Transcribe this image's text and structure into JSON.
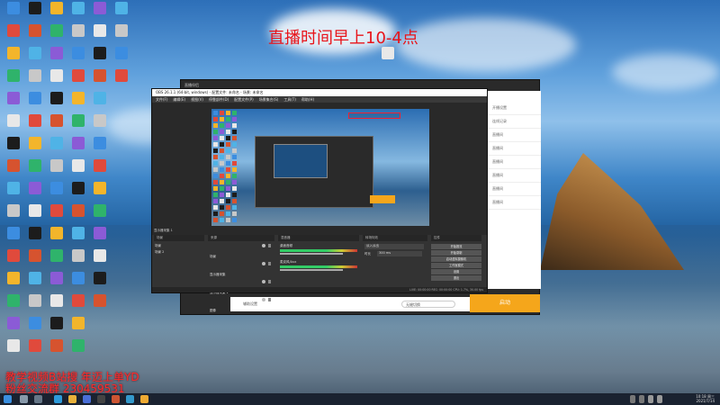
{
  "overlay": {
    "banner": "直播时间早上10-4点",
    "promo_line1": "教学视频B站搜 年迈上单YD",
    "promo_line2": "粉丝交流群 230459531",
    "red_color": "#e8141a"
  },
  "obs": {
    "window_title": "OBS 26.1.1 (64-bit, windows) - 配置文件: 未命名 - 场景: 未命名",
    "menu": [
      "文件(F)",
      "编辑(E)",
      "视图(V)",
      "停靠部件(D)",
      "配置文件(P)",
      "场景集合(S)",
      "工具(T)",
      "帮助(H)"
    ],
    "source_bar": "显示器采集 1",
    "panels": {
      "scenes_header": "场景",
      "sources_header": "来源",
      "mixer_header": "混音器",
      "transitions_header": "转场特效",
      "controls_header": "控件"
    },
    "scenes": [
      "场景",
      "场景 2"
    ],
    "sources": [
      "场景",
      "显示器采集",
      "显示器采集 2",
      "图像"
    ],
    "mixer": [
      "桌面音频",
      "麦克风/Aux"
    ],
    "transition": {
      "type": "淡入淡出",
      "duration_label": "时长",
      "duration": "300 ms"
    },
    "controls": [
      "开始推流",
      "开始录制",
      "启动虚拟摄像机",
      "工作室模式",
      "设置",
      "退出"
    ],
    "status": "LIVE: 00:00:00   REC: 00:00:00   CPU: 1.7%, 30.00 fps"
  },
  "live_window": {
    "title": "直播伴侣",
    "start_button": "启动",
    "bottom_label": "辅助设置",
    "mode_label": "无缝切换",
    "side_items": [
      "开播设置",
      "连线记录",
      "直播间",
      "直播间",
      "直播间",
      "直播间",
      "直播间",
      "直播间"
    ]
  },
  "taskbar": {
    "time": "10:18 周三",
    "date": "2021/7/14"
  }
}
